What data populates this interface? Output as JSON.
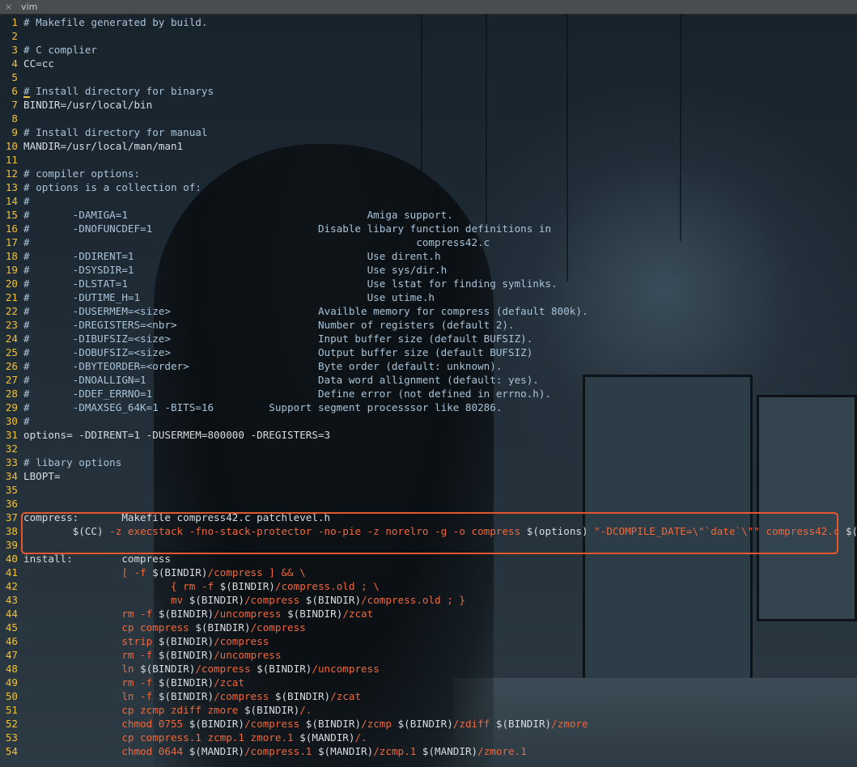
{
  "window": {
    "tab_title": "vim",
    "close_glyph": "×"
  },
  "editor": {
    "highlight_color": "#e4572e",
    "line_number_color": "#f0c13c",
    "lines": [
      {
        "n": "1",
        "segments": [
          {
            "t": "# Makefile generated by build.",
            "k": "comment"
          }
        ]
      },
      {
        "n": "2",
        "segments": []
      },
      {
        "n": "3",
        "segments": [
          {
            "t": "# C complier",
            "k": "comment"
          }
        ]
      },
      {
        "n": "4",
        "segments": [
          {
            "t": "CC=cc",
            "k": "var"
          }
        ]
      },
      {
        "n": "5",
        "segments": []
      },
      {
        "n": "6",
        "segments": [
          {
            "t": "# Install directory for binarys",
            "k": "comment"
          }
        ]
      },
      {
        "n": "7",
        "segments": [
          {
            "t": "BINDIR=/usr/local/bin",
            "k": "var"
          }
        ]
      },
      {
        "n": "8",
        "segments": []
      },
      {
        "n": "9",
        "segments": [
          {
            "t": "# Install directory for manual",
            "k": "comment"
          }
        ]
      },
      {
        "n": "10",
        "segments": [
          {
            "t": "MANDIR=/usr/local/man/man1",
            "k": "var"
          }
        ]
      },
      {
        "n": "11",
        "segments": []
      },
      {
        "n": "12",
        "segments": [
          {
            "t": "# compiler options:",
            "k": "comment"
          }
        ]
      },
      {
        "n": "13",
        "segments": [
          {
            "t": "# options is a collection of:",
            "k": "comment"
          }
        ]
      },
      {
        "n": "14",
        "segments": [
          {
            "t": "#",
            "k": "comment"
          }
        ]
      },
      {
        "n": "15",
        "segments": [
          {
            "t": "#       -DAMIGA=1                                       Amiga support.",
            "k": "comment"
          }
        ]
      },
      {
        "n": "16",
        "segments": [
          {
            "t": "#       -DNOFUNCDEF=1                           Disable libary function definitions in",
            "k": "comment"
          }
        ]
      },
      {
        "n": "17",
        "segments": [
          {
            "t": "#                                                               compress42.c",
            "k": "comment"
          }
        ]
      },
      {
        "n": "18",
        "segments": [
          {
            "t": "#       -DDIRENT=1                                      Use dirent.h",
            "k": "comment"
          }
        ]
      },
      {
        "n": "19",
        "segments": [
          {
            "t": "#       -DSYSDIR=1                                      Use sys/dir.h",
            "k": "comment"
          }
        ]
      },
      {
        "n": "20",
        "segments": [
          {
            "t": "#       -DLSTAT=1                                       Use lstat for finding symlinks.",
            "k": "comment"
          }
        ]
      },
      {
        "n": "21",
        "segments": [
          {
            "t": "#       -DUTIME_H=1                                     Use utime.h",
            "k": "comment"
          }
        ]
      },
      {
        "n": "22",
        "segments": [
          {
            "t": "#       -DUSERMEM=<size>                        Availble memory for compress (default 800k).",
            "k": "comment"
          }
        ]
      },
      {
        "n": "23",
        "segments": [
          {
            "t": "#       -DREGISTERS=<nbr>                       Number of registers (default 2).",
            "k": "comment"
          }
        ]
      },
      {
        "n": "24",
        "segments": [
          {
            "t": "#       -DIBUFSIZ=<size>                        Input buffer size (default BUFSIZ).",
            "k": "comment"
          }
        ]
      },
      {
        "n": "25",
        "segments": [
          {
            "t": "#       -DOBUFSIZ=<size>                        Output buffer size (default BUFSIZ)",
            "k": "comment"
          }
        ]
      },
      {
        "n": "26",
        "segments": [
          {
            "t": "#       -DBYTEORDER=<order>                     Byte order (default: unknown).",
            "k": "comment"
          }
        ]
      },
      {
        "n": "27",
        "segments": [
          {
            "t": "#       -DNOALLIGN=1                            Data word allignment (default: yes).",
            "k": "comment"
          }
        ]
      },
      {
        "n": "28",
        "segments": [
          {
            "t": "#       -DDEF_ERRNO=1                           Define error (not defined in errno.h).",
            "k": "comment"
          }
        ]
      },
      {
        "n": "29",
        "segments": [
          {
            "t": "#       -DMAXSEG_64K=1 -BITS=16         Support segment processsor like 80286.",
            "k": "comment"
          }
        ]
      },
      {
        "n": "30",
        "segments": [
          {
            "t": "#",
            "k": "comment"
          }
        ]
      },
      {
        "n": "31",
        "segments": [
          {
            "t": "options= -DDIRENT=1 -DUSERMEM=800000 -DREGISTERS=3",
            "k": "var"
          }
        ]
      },
      {
        "n": "32",
        "segments": []
      },
      {
        "n": "33",
        "segments": [
          {
            "t": "# libary options",
            "k": "comment"
          }
        ]
      },
      {
        "n": "34",
        "segments": [
          {
            "t": "LBOPT=",
            "k": "var"
          }
        ]
      },
      {
        "n": "35",
        "segments": []
      },
      {
        "n": "36",
        "segments": []
      },
      {
        "n": "37",
        "segments": [
          {
            "t": "compress:       Makefile compress42.c patchlevel.h",
            "k": "text"
          }
        ]
      },
      {
        "n": "38",
        "segments": [
          {
            "t": "        $(CC) ",
            "k": "text"
          },
          {
            "t": "-z execstack -fno-stack-protector -no-pie -z norelro -g -o compress ",
            "k": "cmd"
          },
          {
            "t": "$(options) ",
            "k": "text"
          },
          {
            "t": "\"-DCOMPILE_DATE=\\\"`date`\\\"\" compress42.c ",
            "k": "cmd"
          },
          {
            "t": "$(LBOPT)",
            "k": "text"
          }
        ]
      },
      {
        "n": "39",
        "segments": []
      },
      {
        "n": "40",
        "segments": [
          {
            "t": "install:        compress",
            "k": "text"
          }
        ]
      },
      {
        "n": "41",
        "segments": [
          {
            "t": "                [ -f ",
            "k": "cmd"
          },
          {
            "t": "$(BINDIR)",
            "k": "text"
          },
          {
            "t": "/compress ] && \\",
            "k": "cmd"
          }
        ]
      },
      {
        "n": "42",
        "segments": [
          {
            "t": "                        { rm -f ",
            "k": "cmd"
          },
          {
            "t": "$(BINDIR)",
            "k": "text"
          },
          {
            "t": "/compress.old ; \\",
            "k": "cmd"
          }
        ]
      },
      {
        "n": "43",
        "segments": [
          {
            "t": "                        mv ",
            "k": "cmd"
          },
          {
            "t": "$(BINDIR)",
            "k": "text"
          },
          {
            "t": "/compress ",
            "k": "cmd"
          },
          {
            "t": "$(BINDIR)",
            "k": "text"
          },
          {
            "t": "/compress.old ; }",
            "k": "cmd"
          }
        ]
      },
      {
        "n": "44",
        "segments": [
          {
            "t": "                rm -f ",
            "k": "cmd"
          },
          {
            "t": "$(BINDIR)",
            "k": "text"
          },
          {
            "t": "/uncompress ",
            "k": "cmd"
          },
          {
            "t": "$(BINDIR)",
            "k": "text"
          },
          {
            "t": "/zcat",
            "k": "cmd"
          }
        ]
      },
      {
        "n": "45",
        "segments": [
          {
            "t": "                cp compress ",
            "k": "cmd"
          },
          {
            "t": "$(BINDIR)",
            "k": "text"
          },
          {
            "t": "/compress",
            "k": "cmd"
          }
        ]
      },
      {
        "n": "46",
        "segments": [
          {
            "t": "                strip ",
            "k": "cmd"
          },
          {
            "t": "$(BINDIR)",
            "k": "text"
          },
          {
            "t": "/compress",
            "k": "cmd"
          }
        ]
      },
      {
        "n": "47",
        "segments": [
          {
            "t": "                rm -f ",
            "k": "cmd"
          },
          {
            "t": "$(BINDIR)",
            "k": "text"
          },
          {
            "t": "/uncompress",
            "k": "cmd"
          }
        ]
      },
      {
        "n": "48",
        "segments": [
          {
            "t": "                ln ",
            "k": "cmd"
          },
          {
            "t": "$(BINDIR)",
            "k": "text"
          },
          {
            "t": "/compress ",
            "k": "cmd"
          },
          {
            "t": "$(BINDIR)",
            "k": "text"
          },
          {
            "t": "/uncompress",
            "k": "cmd"
          }
        ]
      },
      {
        "n": "49",
        "segments": [
          {
            "t": "                rm -f ",
            "k": "cmd"
          },
          {
            "t": "$(BINDIR)",
            "k": "text"
          },
          {
            "t": "/zcat",
            "k": "cmd"
          }
        ]
      },
      {
        "n": "50",
        "segments": [
          {
            "t": "                ln -f ",
            "k": "cmd"
          },
          {
            "t": "$(BINDIR)",
            "k": "text"
          },
          {
            "t": "/compress ",
            "k": "cmd"
          },
          {
            "t": "$(BINDIR)",
            "k": "text"
          },
          {
            "t": "/zcat",
            "k": "cmd"
          }
        ]
      },
      {
        "n": "51",
        "segments": [
          {
            "t": "                cp zcmp zdiff zmore ",
            "k": "cmd"
          },
          {
            "t": "$(BINDIR)",
            "k": "text"
          },
          {
            "t": "/.",
            "k": "cmd"
          }
        ]
      },
      {
        "n": "52",
        "segments": [
          {
            "t": "                chmod 0755 ",
            "k": "cmd"
          },
          {
            "t": "$(BINDIR)",
            "k": "text"
          },
          {
            "t": "/compress ",
            "k": "cmd"
          },
          {
            "t": "$(BINDIR)",
            "k": "text"
          },
          {
            "t": "/zcmp ",
            "k": "cmd"
          },
          {
            "t": "$(BINDIR)",
            "k": "text"
          },
          {
            "t": "/zdiff ",
            "k": "cmd"
          },
          {
            "t": "$(BINDIR)",
            "k": "text"
          },
          {
            "t": "/zmore",
            "k": "cmd"
          }
        ]
      },
      {
        "n": "53",
        "segments": [
          {
            "t": "                cp compress.1 zcmp.1 zmore.1 ",
            "k": "cmd"
          },
          {
            "t": "$(MANDIR)",
            "k": "text"
          },
          {
            "t": "/.",
            "k": "cmd"
          }
        ]
      },
      {
        "n": "54",
        "segments": [
          {
            "t": "                chmod 0644 ",
            "k": "cmd"
          },
          {
            "t": "$(MANDIR)",
            "k": "text"
          },
          {
            "t": "/compress.1 ",
            "k": "cmd"
          },
          {
            "t": "$(MANDIR)",
            "k": "text"
          },
          {
            "t": "/zcmp.1 ",
            "k": "cmd"
          },
          {
            "t": "$(MANDIR)",
            "k": "text"
          },
          {
            "t": "/zmore.1",
            "k": "cmd"
          }
        ]
      }
    ]
  }
}
